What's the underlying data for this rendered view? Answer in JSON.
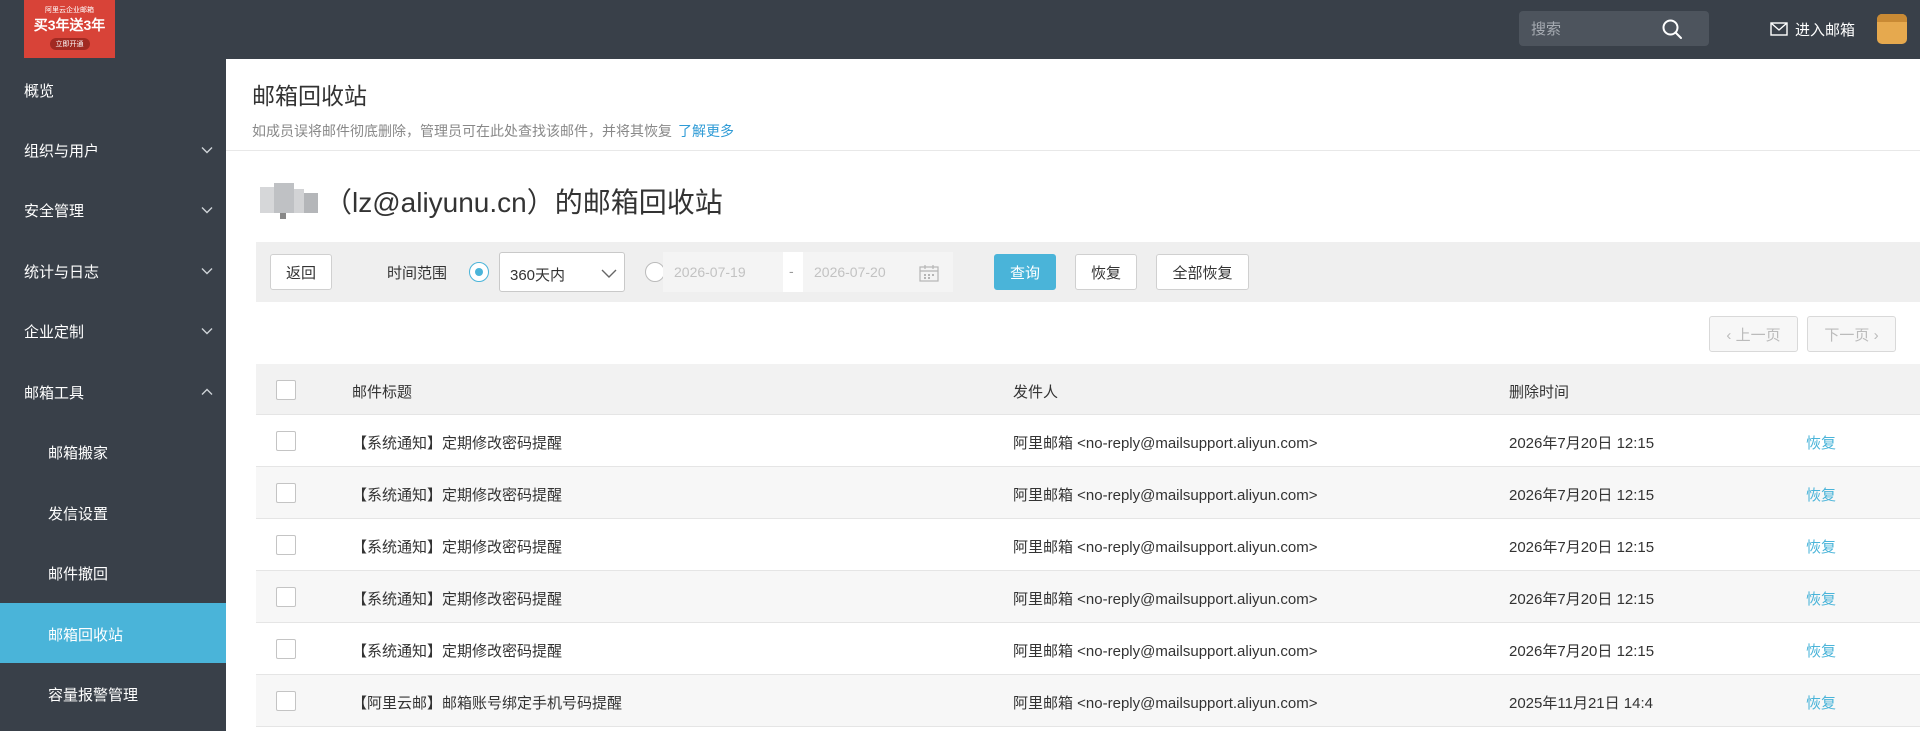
{
  "topbar": {
    "logo": {
      "line1": "阿里云企业邮箱",
      "line2": "买3年送3年",
      "line3": "立即开通"
    },
    "search_placeholder": "搜索",
    "enter_mail": "进入邮箱"
  },
  "sidebar": {
    "items": [
      {
        "label": "概览"
      },
      {
        "label": "组织与用户"
      },
      {
        "label": "安全管理"
      },
      {
        "label": "统计与日志"
      },
      {
        "label": "企业定制"
      },
      {
        "label": "邮箱工具"
      },
      {
        "label": "邮箱搬家"
      },
      {
        "label": "发信设置"
      },
      {
        "label": "邮件撤回"
      },
      {
        "label": "邮箱回收站"
      },
      {
        "label": "容量报警管理"
      }
    ]
  },
  "page": {
    "title": "邮箱回收站",
    "description": "如成员误将邮件彻底删除，管理员可在此处查找该邮件，并将其恢复",
    "learn_more": "了解更多",
    "user_heading": "（lz@aliyunu.cn）的邮箱回收站"
  },
  "filter": {
    "back": "返回",
    "time_range_label": "时间范围",
    "select_value": "360天内",
    "date_from": "2026-07-19",
    "date_sep": "-",
    "date_to": "2026-07-20",
    "query": "查询",
    "restore": "恢复",
    "restore_all": "全部恢复"
  },
  "pager": {
    "prev": "‹ 上一页",
    "next": "下一页 ›"
  },
  "table": {
    "headers": {
      "subject": "邮件标题",
      "from": "发件人",
      "time": "删除时间"
    },
    "rows": [
      {
        "subject": "【系统通知】定期修改密码提醒",
        "from": "阿里邮箱 <no-reply@mailsupport.aliyun.com>",
        "time": "2026年7月20日 12:15",
        "action": "恢复"
      },
      {
        "subject": "【系统通知】定期修改密码提醒",
        "from": "阿里邮箱 <no-reply@mailsupport.aliyun.com>",
        "time": "2026年7月20日 12:15",
        "action": "恢复"
      },
      {
        "subject": "【系统通知】定期修改密码提醒",
        "from": "阿里邮箱 <no-reply@mailsupport.aliyun.com>",
        "time": "2026年7月20日 12:15",
        "action": "恢复"
      },
      {
        "subject": "【系统通知】定期修改密码提醒",
        "from": "阿里邮箱 <no-reply@mailsupport.aliyun.com>",
        "time": "2026年7月20日 12:15",
        "action": "恢复"
      },
      {
        "subject": "【系统通知】定期修改密码提醒",
        "from": "阿里邮箱 <no-reply@mailsupport.aliyun.com>",
        "time": "2026年7月20日 12:15",
        "action": "恢复"
      },
      {
        "subject": "【阿里云邮】邮箱账号绑定手机号码提醒",
        "from": "阿里邮箱 <no-reply@mailsupport.aliyun.com>",
        "time": "2025年11月21日 14:4",
        "action": "恢复"
      }
    ]
  },
  "colors": {
    "sidebar_bg": "#394049",
    "accent": "#4ab4d9",
    "logo_bg": "#d84338"
  }
}
